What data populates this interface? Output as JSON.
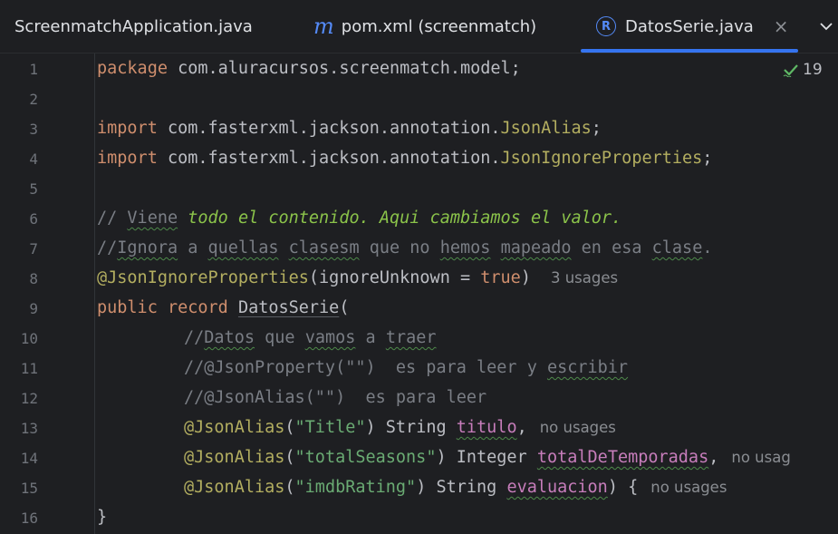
{
  "tabs": [
    {
      "label": "ScreenmatchApplication.java",
      "icon": "java-file-icon"
    },
    {
      "label": "pom.xml (screenmatch)",
      "icon": "maven-icon",
      "icon_glyph": "m"
    },
    {
      "label": "DatosSerie.java",
      "icon": "record-icon",
      "icon_glyph": "R",
      "active": true,
      "close": "×"
    }
  ],
  "inspection_count": "19",
  "line_numbers": [
    "1",
    "2",
    "3",
    "4",
    "5",
    "6",
    "7",
    "8",
    "9",
    "10",
    "11",
    "12",
    "13",
    "14",
    "15",
    "16"
  ],
  "code": {
    "l1": {
      "kw": "package",
      "rest": " com.aluracursos.screenmatch.model;"
    },
    "l3": {
      "kw": "import",
      "pkg": " com.fasterxml.jackson.annotation.",
      "cls": "JsonAlias",
      "end": ";"
    },
    "l4": {
      "kw": "import",
      "pkg": " com.fasterxml.jackson.annotation.",
      "cls": "JsonIgnoreProperties",
      "end": ";"
    },
    "l6": {
      "a": "// ",
      "b": "Viene",
      "c": " todo el contenido. Aqui cambiamos el valor."
    },
    "l7": {
      "a": "//",
      "b": "Ignora",
      "c": " a ",
      "d": "quellas",
      "e": " ",
      "f": "clasesm",
      "g": " que no ",
      "h": "hemos",
      "i": " ",
      "j": "mapeado",
      "k": " en esa ",
      "l": "clase",
      "m": "."
    },
    "l8": {
      "ann": "@JsonIgnoreProperties",
      "p1": "(ignoreUnknown = ",
      "kw": "true",
      "p2": ")",
      "hint": "3 usages"
    },
    "l9": {
      "kw1": "public",
      "kw2": " record ",
      "name": "DatosSerie",
      "p": "("
    },
    "l10": {
      "a": "//",
      "b": "Datos",
      "c": " que ",
      "d": "vamos",
      "e": " a ",
      "f": "traer"
    },
    "l11": {
      "a": "//@JsonProperty(\"\")  es para leer y ",
      "b": "escribir"
    },
    "l12": {
      "a": "//@JsonAlias(\"\")  es para leer"
    },
    "l13": {
      "ann": "@JsonAlias",
      "p1": "(",
      "str": "\"Title\"",
      "p2": ") String ",
      "fld": "titulo",
      "end": ",",
      "hint": "no usages"
    },
    "l14": {
      "ann": "@JsonAlias",
      "p1": "(",
      "str": "\"totalSeasons\"",
      "p2": ") Integer ",
      "fld": "totalDeTemporadas",
      "end": ",",
      "hint": "no usag"
    },
    "l15": {
      "ann": "@JsonAlias",
      "p1": "(",
      "str": "\"imdbRating\"",
      "p2": ") String ",
      "fld": "evaluacion",
      "end": ") {",
      "hint": "no usages"
    },
    "l16": {
      "a": "}"
    }
  }
}
